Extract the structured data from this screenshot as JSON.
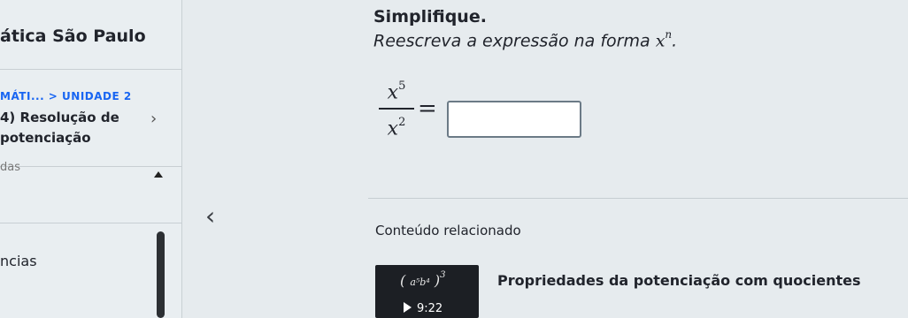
{
  "sidebar": {
    "course_title": "ática São Paulo",
    "breadcrumb": "MÁTI... > UNIDADE 2",
    "lesson": "4) Resolução de potenciação",
    "section": "das",
    "list_label": "ncias"
  },
  "question": {
    "title": "Simplifique.",
    "instruction_prefix": "Reescreva a expressão na forma ",
    "instruction_var": "x",
    "instruction_exp": "n",
    "instruction_suffix": ".",
    "numerator_base": "x",
    "numerator_exp": "5",
    "denominator_base": "x",
    "denominator_exp": "2",
    "equals": "=",
    "answer_value": "",
    "keypad_icon": "keypad-icon"
  },
  "related": {
    "heading": "Conteúdo relacionado",
    "video": {
      "title": "Propriedades da potenciação com quocientes",
      "duration": "9:22"
    }
  },
  "colors": {
    "background": "#e6ebee",
    "link": "#1865f2",
    "text": "#21242c"
  }
}
